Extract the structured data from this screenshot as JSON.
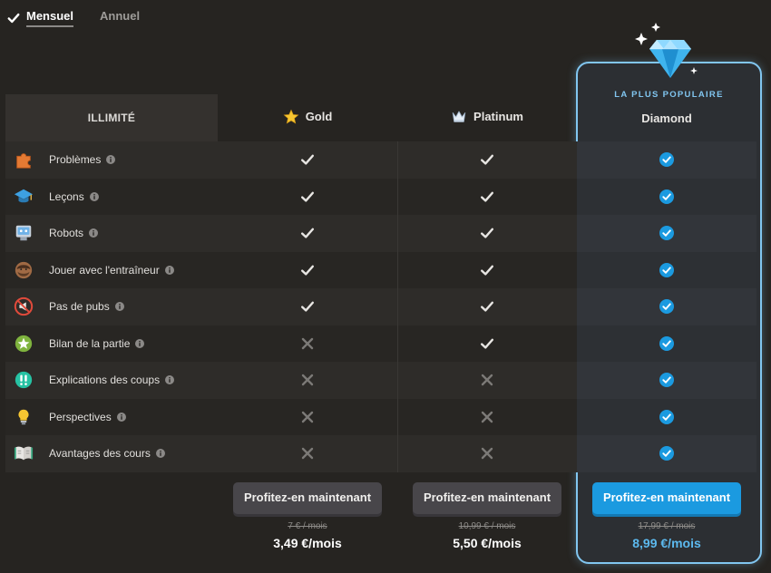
{
  "billing": {
    "monthly_label": "Mensuel",
    "annual_label": "Annuel",
    "selected": "monthly"
  },
  "table": {
    "header_label": "ILLIMITÉ",
    "popular_badge": "LA PLUS POPULAIRE",
    "plans": [
      {
        "name": "Gold",
        "icon": "star-icon",
        "cta": "Profitez-en maintenant",
        "old_price": "7 € / mois",
        "price": "3,49 €/mois",
        "highlight": false
      },
      {
        "name": "Platinum",
        "icon": "crown-icon",
        "cta": "Profitez-en maintenant",
        "old_price": "10,99 € / mois",
        "price": "5,50 €/mois",
        "highlight": false
      },
      {
        "name": "Diamond",
        "icon": "diamond-icon",
        "cta": "Profitez-en maintenant",
        "old_price": "17,99 € / mois",
        "price": "8,99 €/mois",
        "highlight": true
      }
    ],
    "features": [
      {
        "name": "Problèmes",
        "icon": "puzzle-icon",
        "gold": true,
        "platinum": true,
        "diamond": true
      },
      {
        "name": "Leçons",
        "icon": "graduation-cap-icon",
        "gold": true,
        "platinum": true,
        "diamond": true
      },
      {
        "name": "Robots",
        "icon": "robot-icon",
        "gold": true,
        "platinum": true,
        "diamond": true
      },
      {
        "name": "Jouer avec l'entraîneur",
        "icon": "coach-icon",
        "gold": true,
        "platinum": true,
        "diamond": true
      },
      {
        "name": "Pas de pubs",
        "icon": "no-ads-icon",
        "gold": true,
        "platinum": true,
        "diamond": true
      },
      {
        "name": "Bilan de la partie",
        "icon": "game-review-star-icon",
        "gold": false,
        "platinum": true,
        "diamond": true
      },
      {
        "name": "Explications des coups",
        "icon": "double-exclamation-icon",
        "gold": false,
        "platinum": false,
        "diamond": true
      },
      {
        "name": "Perspectives",
        "icon": "lightbulb-icon",
        "gold": false,
        "platinum": false,
        "diamond": true
      },
      {
        "name": "Avantages des cours",
        "icon": "book-icon",
        "gold": false,
        "platinum": false,
        "diamond": true
      }
    ]
  },
  "colors": {
    "accent": "#1b9ae0",
    "highlight_border": "#81c6f0",
    "background": "#262421"
  }
}
